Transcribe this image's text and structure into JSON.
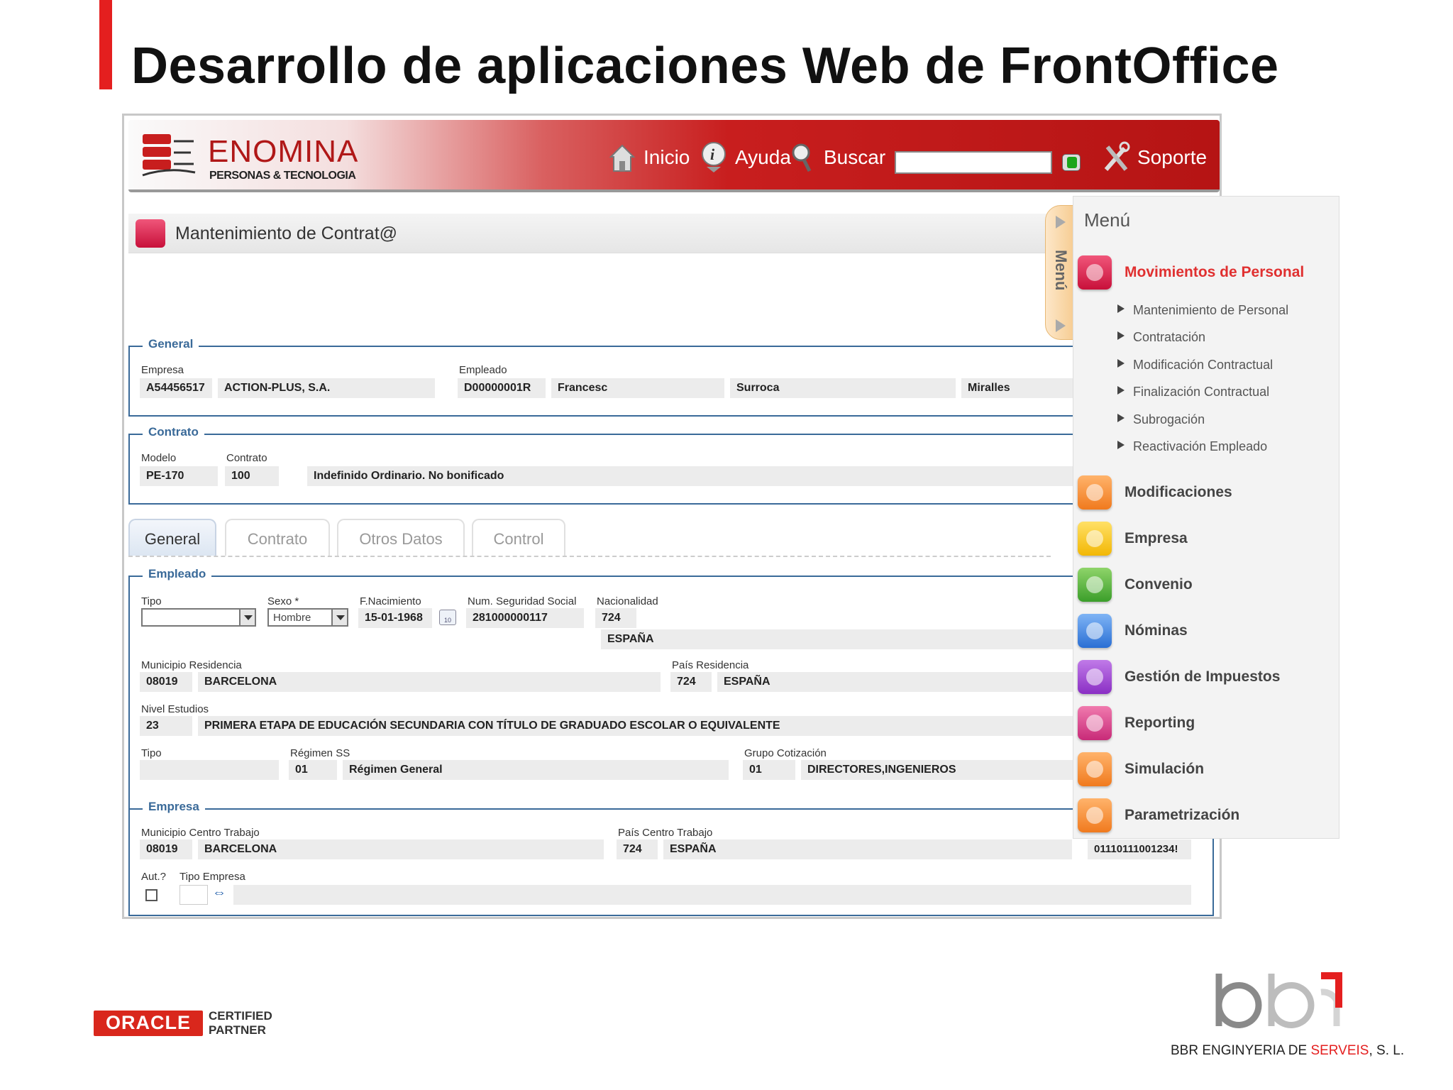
{
  "slide": {
    "title": "Desarrollo de aplicaciones Web de FrontOffice"
  },
  "header": {
    "logo_name": "ENOMINA",
    "logo_sub": "PERSONAS & TECNOLOGIA",
    "nav": {
      "inicio": "Inicio",
      "ayuda": "Ayuda",
      "buscar": "Buscar",
      "soporte": "Soporte"
    },
    "search_value": ""
  },
  "page": {
    "title": "Mantenimiento de Contrat@"
  },
  "general": {
    "legend": "General",
    "empresa_label": "Empresa",
    "empresa_code": "A54456517",
    "empresa_name": "ACTION-PLUS, S.A.",
    "empleado_label": "Empleado",
    "empleado_code": "D00000001R",
    "nombre": "Francesc",
    "apellido1": "Surroca",
    "apellido2": "Miralles"
  },
  "contrato": {
    "legend": "Contrato",
    "modelo_label": "Modelo",
    "modelo": "PE-170",
    "contrato_label": "Contrato",
    "contrato_code": "100",
    "contrato_desc": "Indefinido Ordinario. No bonificado"
  },
  "tabs": [
    "General",
    "Contrato",
    "Otros Datos",
    "Control"
  ],
  "empleado": {
    "legend": "Empleado",
    "tipo_label": "Tipo",
    "tipo_value": "",
    "sexo_label": "Sexo *",
    "sexo_value": "Hombre",
    "fnac_label": "F.Nacimiento",
    "fnac_value": "15-01-1968",
    "nss_label": "Num. Seguridad Social",
    "nss_value": "281000000117",
    "nacionalidad_label": "Nacionalidad",
    "nacionalidad_code": "724",
    "nacionalidad_name": "ESPAÑA",
    "municipio_label": "Municipio Residencia",
    "municipio_code": "08019",
    "municipio_name": "BARCELONA",
    "pais_label": "País Residencia",
    "pais_code": "724",
    "pais_name": "ESPAÑA",
    "nivel_label": "Nivel Estudios",
    "nivel_code": "23",
    "nivel_desc": "PRIMERA ETAPA DE EDUCACIÓN SECUNDARIA CON TÍTULO DE GRADUADO ESCOLAR O EQUIVALENTE",
    "tipo2_label": "Tipo",
    "tipo2_value": "",
    "regimen_label": "Régimen SS",
    "regimen_code": "01",
    "regimen_name": "Régimen General",
    "grupo_label": "Grupo Cotización",
    "grupo_code": "01",
    "grupo_name": "DIRECTORES,INGENIEROS"
  },
  "empresa": {
    "legend": "Empresa",
    "municipio_label": "Municipio Centro Trabajo",
    "municipio_code": "08019",
    "municipio_name": "BARCELONA",
    "pais_label": "País Centro Trabajo",
    "pais_code": "724",
    "pais_name": "ESPAÑA",
    "ccc_value": "01110111001234!",
    "aut_label": "Aut.?",
    "tipo_empresa_label": "Tipo Empresa",
    "tipo_empresa_value": ""
  },
  "side_tab": {
    "label": "Menú"
  },
  "menu": {
    "title": "Menú",
    "active": "Movimientos de Personal",
    "sub_items": [
      "Mantenimiento de Personal",
      "Contratación",
      "Modificación Contractual",
      "Finalización Contractual",
      "Subrogación",
      "Reactivación Empleado"
    ],
    "items": [
      "Modificaciones",
      "Empresa",
      "Convenio",
      "Nóminas",
      "Gestión de Impuestos",
      "Reporting",
      "Simulación",
      "Parametrización"
    ]
  },
  "footer": {
    "oracle": "ORACLE",
    "oracle_cert_1": "CERTIFIED",
    "oracle_cert_2": "PARTNER",
    "bbr_text_1": "BBR ENGINYERIA DE ",
    "bbr_text_2": "SERVEIS",
    "bbr_text_3": ", S. L."
  },
  "colors": {
    "brand_red": "#e41f1f",
    "header_red": "#c81e1e",
    "group_blue": "#3a6a99",
    "menu_active": "#e03030"
  }
}
